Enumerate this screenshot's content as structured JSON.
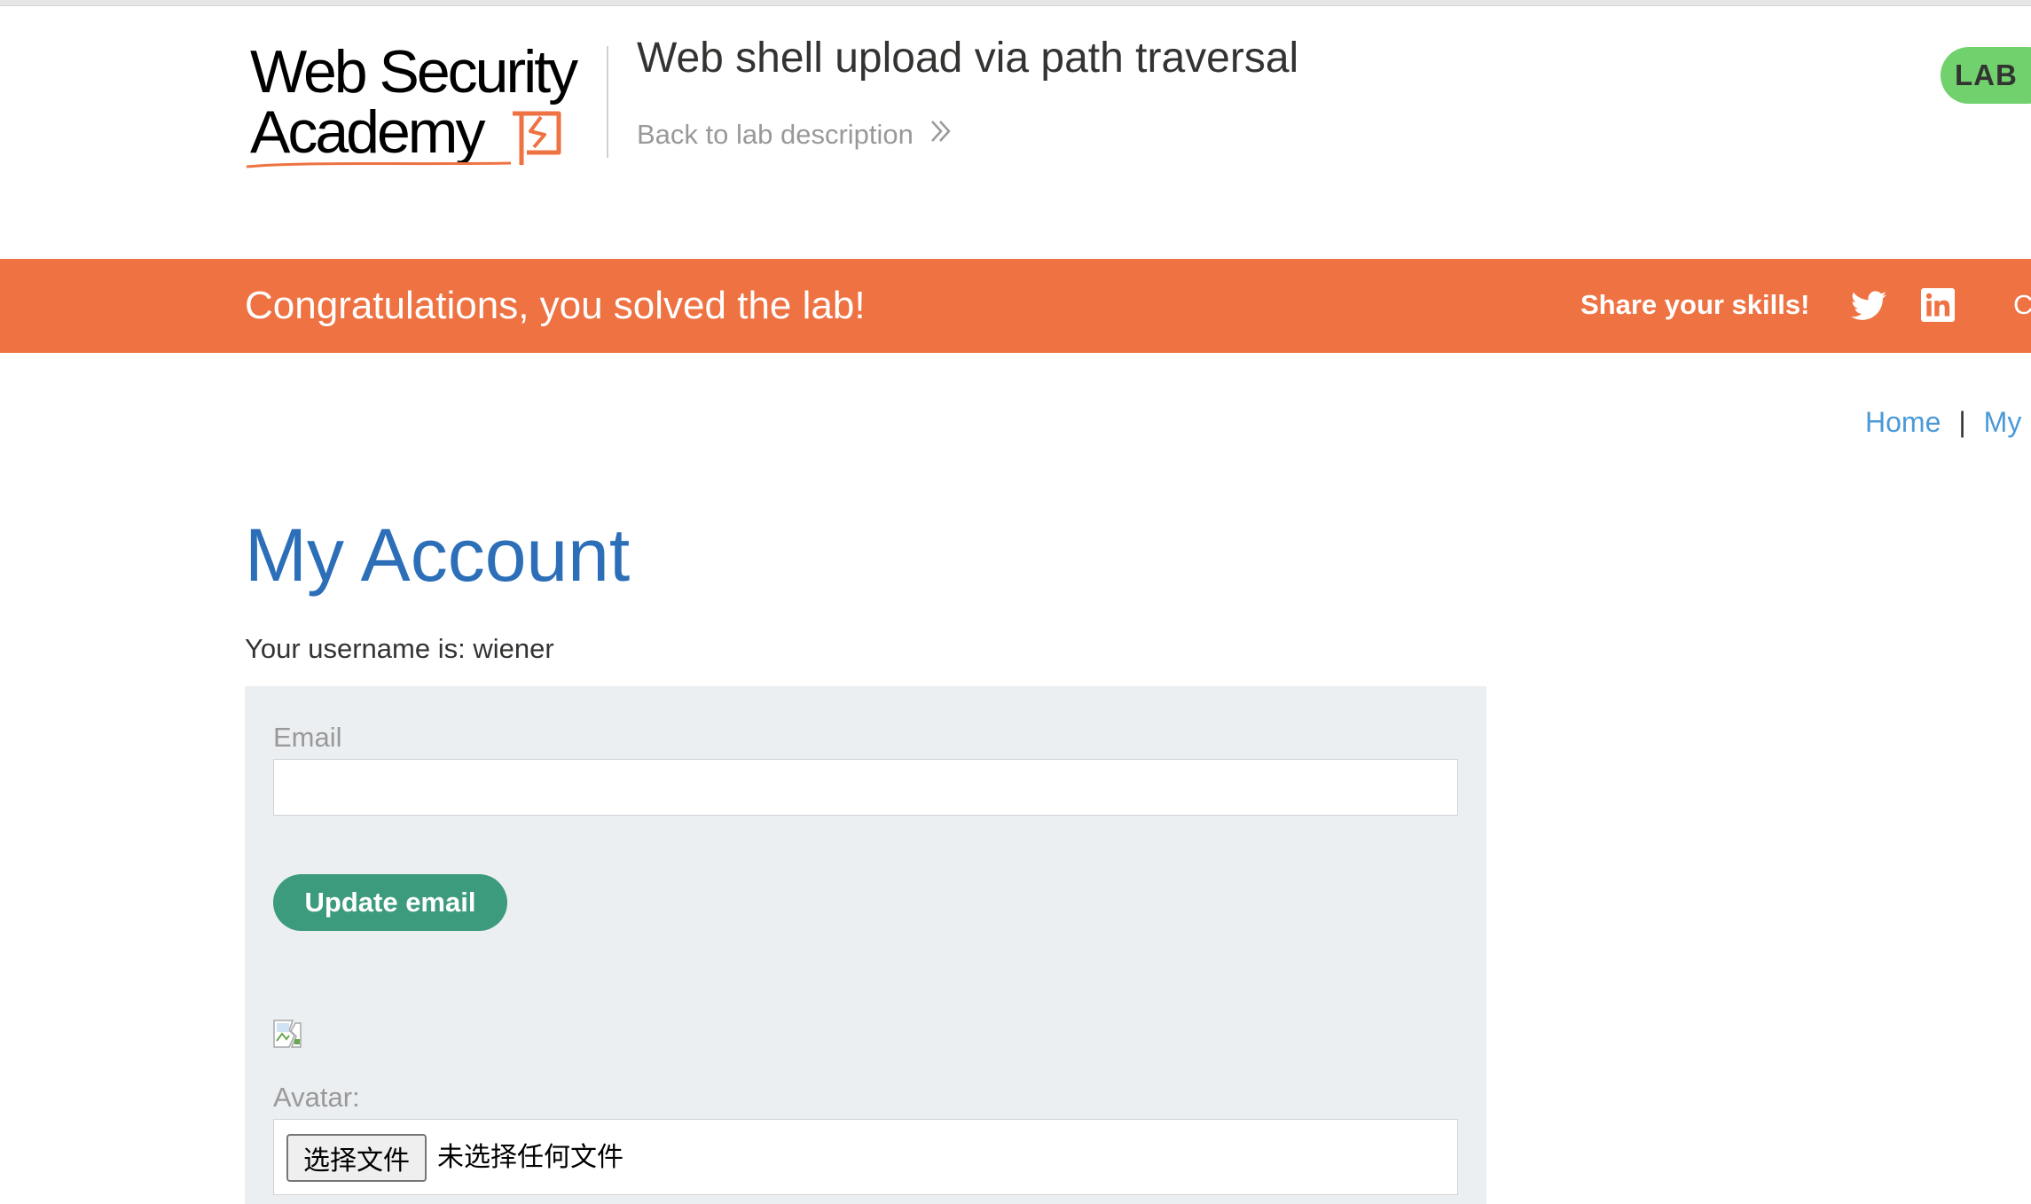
{
  "header": {
    "logo": {
      "line1": "Web Security",
      "line2": "Academy"
    },
    "lab_title": "Web shell upload via path traversal",
    "back_link": "Back to lab description",
    "badge": "LAB"
  },
  "banner": {
    "message": "Congratulations, you solved the lab!",
    "share_label": "Share your skills!",
    "cut_text": "C",
    "color": "#ee7242"
  },
  "nav": {
    "home": "Home",
    "separator": "|",
    "my_account": "My"
  },
  "main": {
    "title": "My Account",
    "username_line": "Your username is: wiener",
    "email_label": "Email",
    "email_value": "",
    "update_button": "Update email",
    "avatar_label": "Avatar:",
    "file_button": "选择文件",
    "file_status": "未选择任何文件"
  },
  "colors": {
    "accent_orange": "#ee7242",
    "title_blue": "#2c6fb8",
    "link_blue": "#4a9ad8",
    "button_green": "#3d9b7d",
    "badge_green": "#70d16d",
    "panel_bg": "#ebeff2"
  },
  "icons": [
    "twitter-icon",
    "linkedin-icon",
    "chevron-right-icon",
    "broken-image-icon"
  ]
}
